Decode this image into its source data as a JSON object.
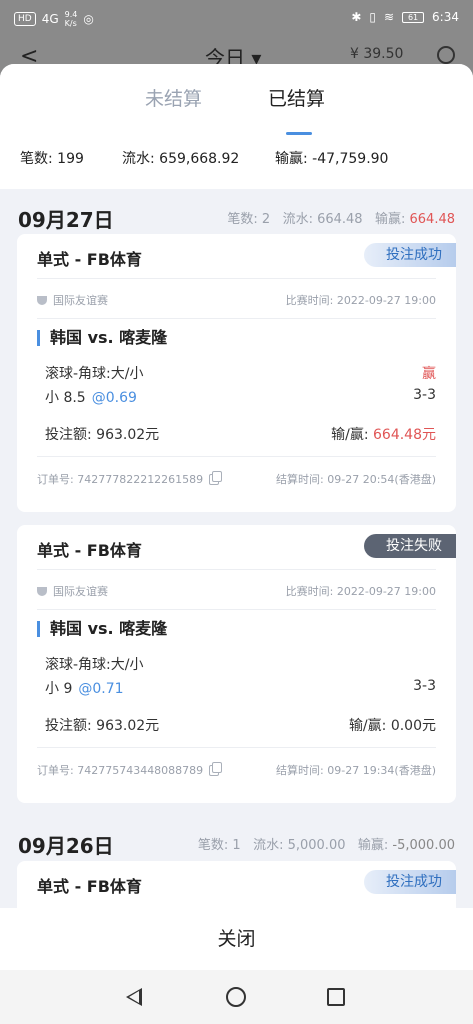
{
  "status_bar": {
    "hd": "HD",
    "signal": "4G",
    "speed": "9.4\nK/s",
    "battery": "61",
    "time": "6:34"
  },
  "background_header": {
    "back_glyph": "<",
    "title": "今日 ▾",
    "balance": "39.50"
  },
  "tabs": {
    "unsettled": "未结算",
    "settled": "已结算"
  },
  "summary": {
    "count": "笔数: 199",
    "turnover": "流水: 659,668.92",
    "winloss": "输赢: -47,759.90"
  },
  "groups": [
    {
      "date": "09月27日",
      "count_label": "笔数: ",
      "count": "2",
      "turnover_label": "流水: ",
      "turnover": "664.48",
      "winloss_label": "输赢: ",
      "winloss": "664.48"
    },
    {
      "date": "09月26日",
      "count_label": "笔数: ",
      "count": "1",
      "turnover_label": "流水: ",
      "turnover": "5,000.00",
      "winloss_label": "输赢: ",
      "winloss": "-5,000.00"
    }
  ],
  "bets": [
    {
      "title": "单式 - FB体育",
      "status": "投注成功",
      "league": "国际友谊赛",
      "match_time": "比赛时间: 2022-09-27 19:00",
      "teams": "韩国 vs. 喀麦隆",
      "market": "滚球-角球:大/小",
      "result_word": "赢",
      "selection": "小 8.5",
      "odds": "@0.69",
      "score": "3-3",
      "stake": "投注额: 963.02元",
      "winloss_label": "输/赢: ",
      "winloss": "664.48元",
      "order_no": "订单号: 742777822212261589",
      "settle_time": "结算时间: 09-27 20:54(香港盘)"
    },
    {
      "title": "单式 - FB体育",
      "status": "投注失败",
      "league": "国际友谊赛",
      "match_time": "比赛时间: 2022-09-27 19:00",
      "teams": "韩国 vs. 喀麦隆",
      "market": "滚球-角球:大/小",
      "result_word": "",
      "selection": "小 9",
      "odds": "@0.71",
      "score": "3-3",
      "stake": "投注额: 963.02元",
      "winloss_label": "输/赢: ",
      "winloss": "0.00元",
      "order_no": "订单号: 742775743448088789",
      "settle_time": "结算时间: 09-27 19:34(香港盘)"
    },
    {
      "title": "单式 - FB体育",
      "status": "投注成功"
    }
  ],
  "close_label": "关闭",
  "colors": {
    "accent": "#4a8fe0",
    "win": "#e05555",
    "fail_badge": "#5c6473"
  }
}
